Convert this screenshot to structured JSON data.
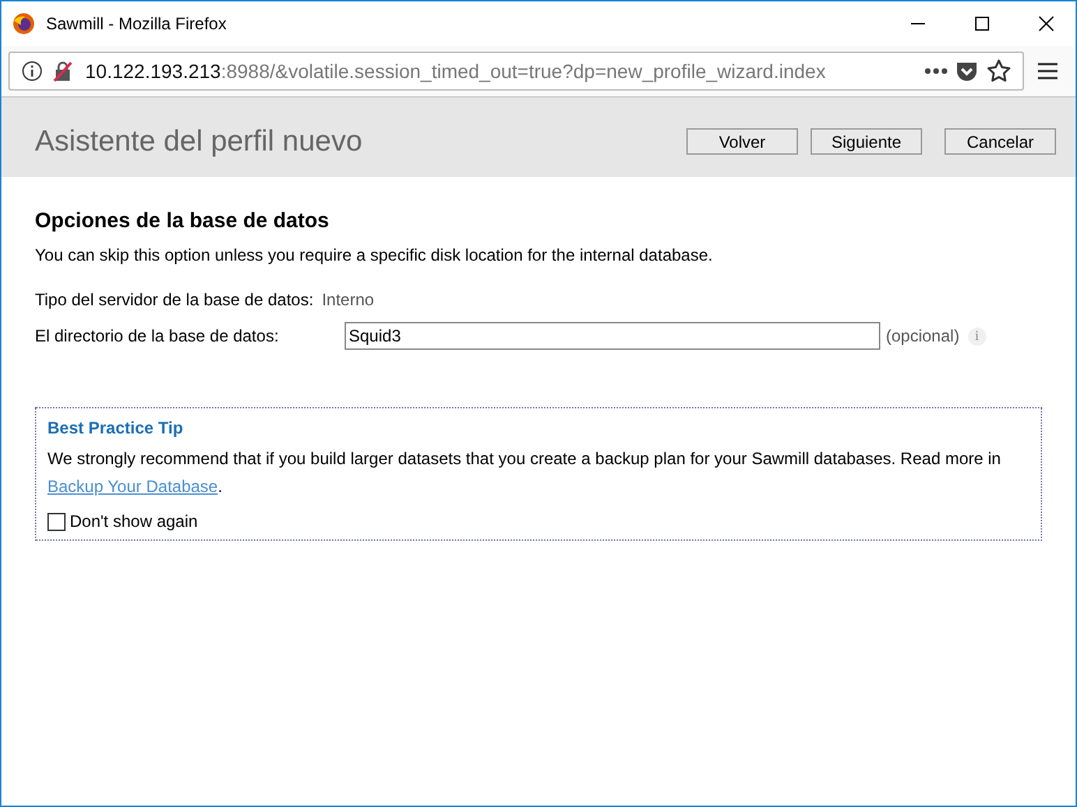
{
  "window": {
    "title": "Sawmill - Mozilla Firefox"
  },
  "address_bar": {
    "host": "10.122.193.213",
    "path": ":8988/&volatile.session_timed_out=true?dp=new_profile_wizard.index"
  },
  "header": {
    "title": "Asistente del perfil nuevo",
    "buttons": [
      "Volver",
      "Siguiente",
      "Cancelar"
    ]
  },
  "section": {
    "heading": "Opciones de la base de datos",
    "description": "You can skip this option unless you require a specific disk location for the internal database."
  },
  "server_type": {
    "label": "Tipo del servidor de la base de datos:",
    "value": "Interno"
  },
  "directory": {
    "label": "El directorio de la base de datos:",
    "value": "Squid3",
    "note": "(opcional)",
    "info": "i"
  },
  "tip": {
    "title": "Best Practice Tip",
    "text_before": "We strongly recommend that if you build larger datasets that you create a backup plan for your Sawmill databases. Read more in ",
    "link": "Backup Your Database",
    "text_after": ".",
    "checkbox": {
      "label": "Don't show again",
      "checked": false
    }
  }
}
